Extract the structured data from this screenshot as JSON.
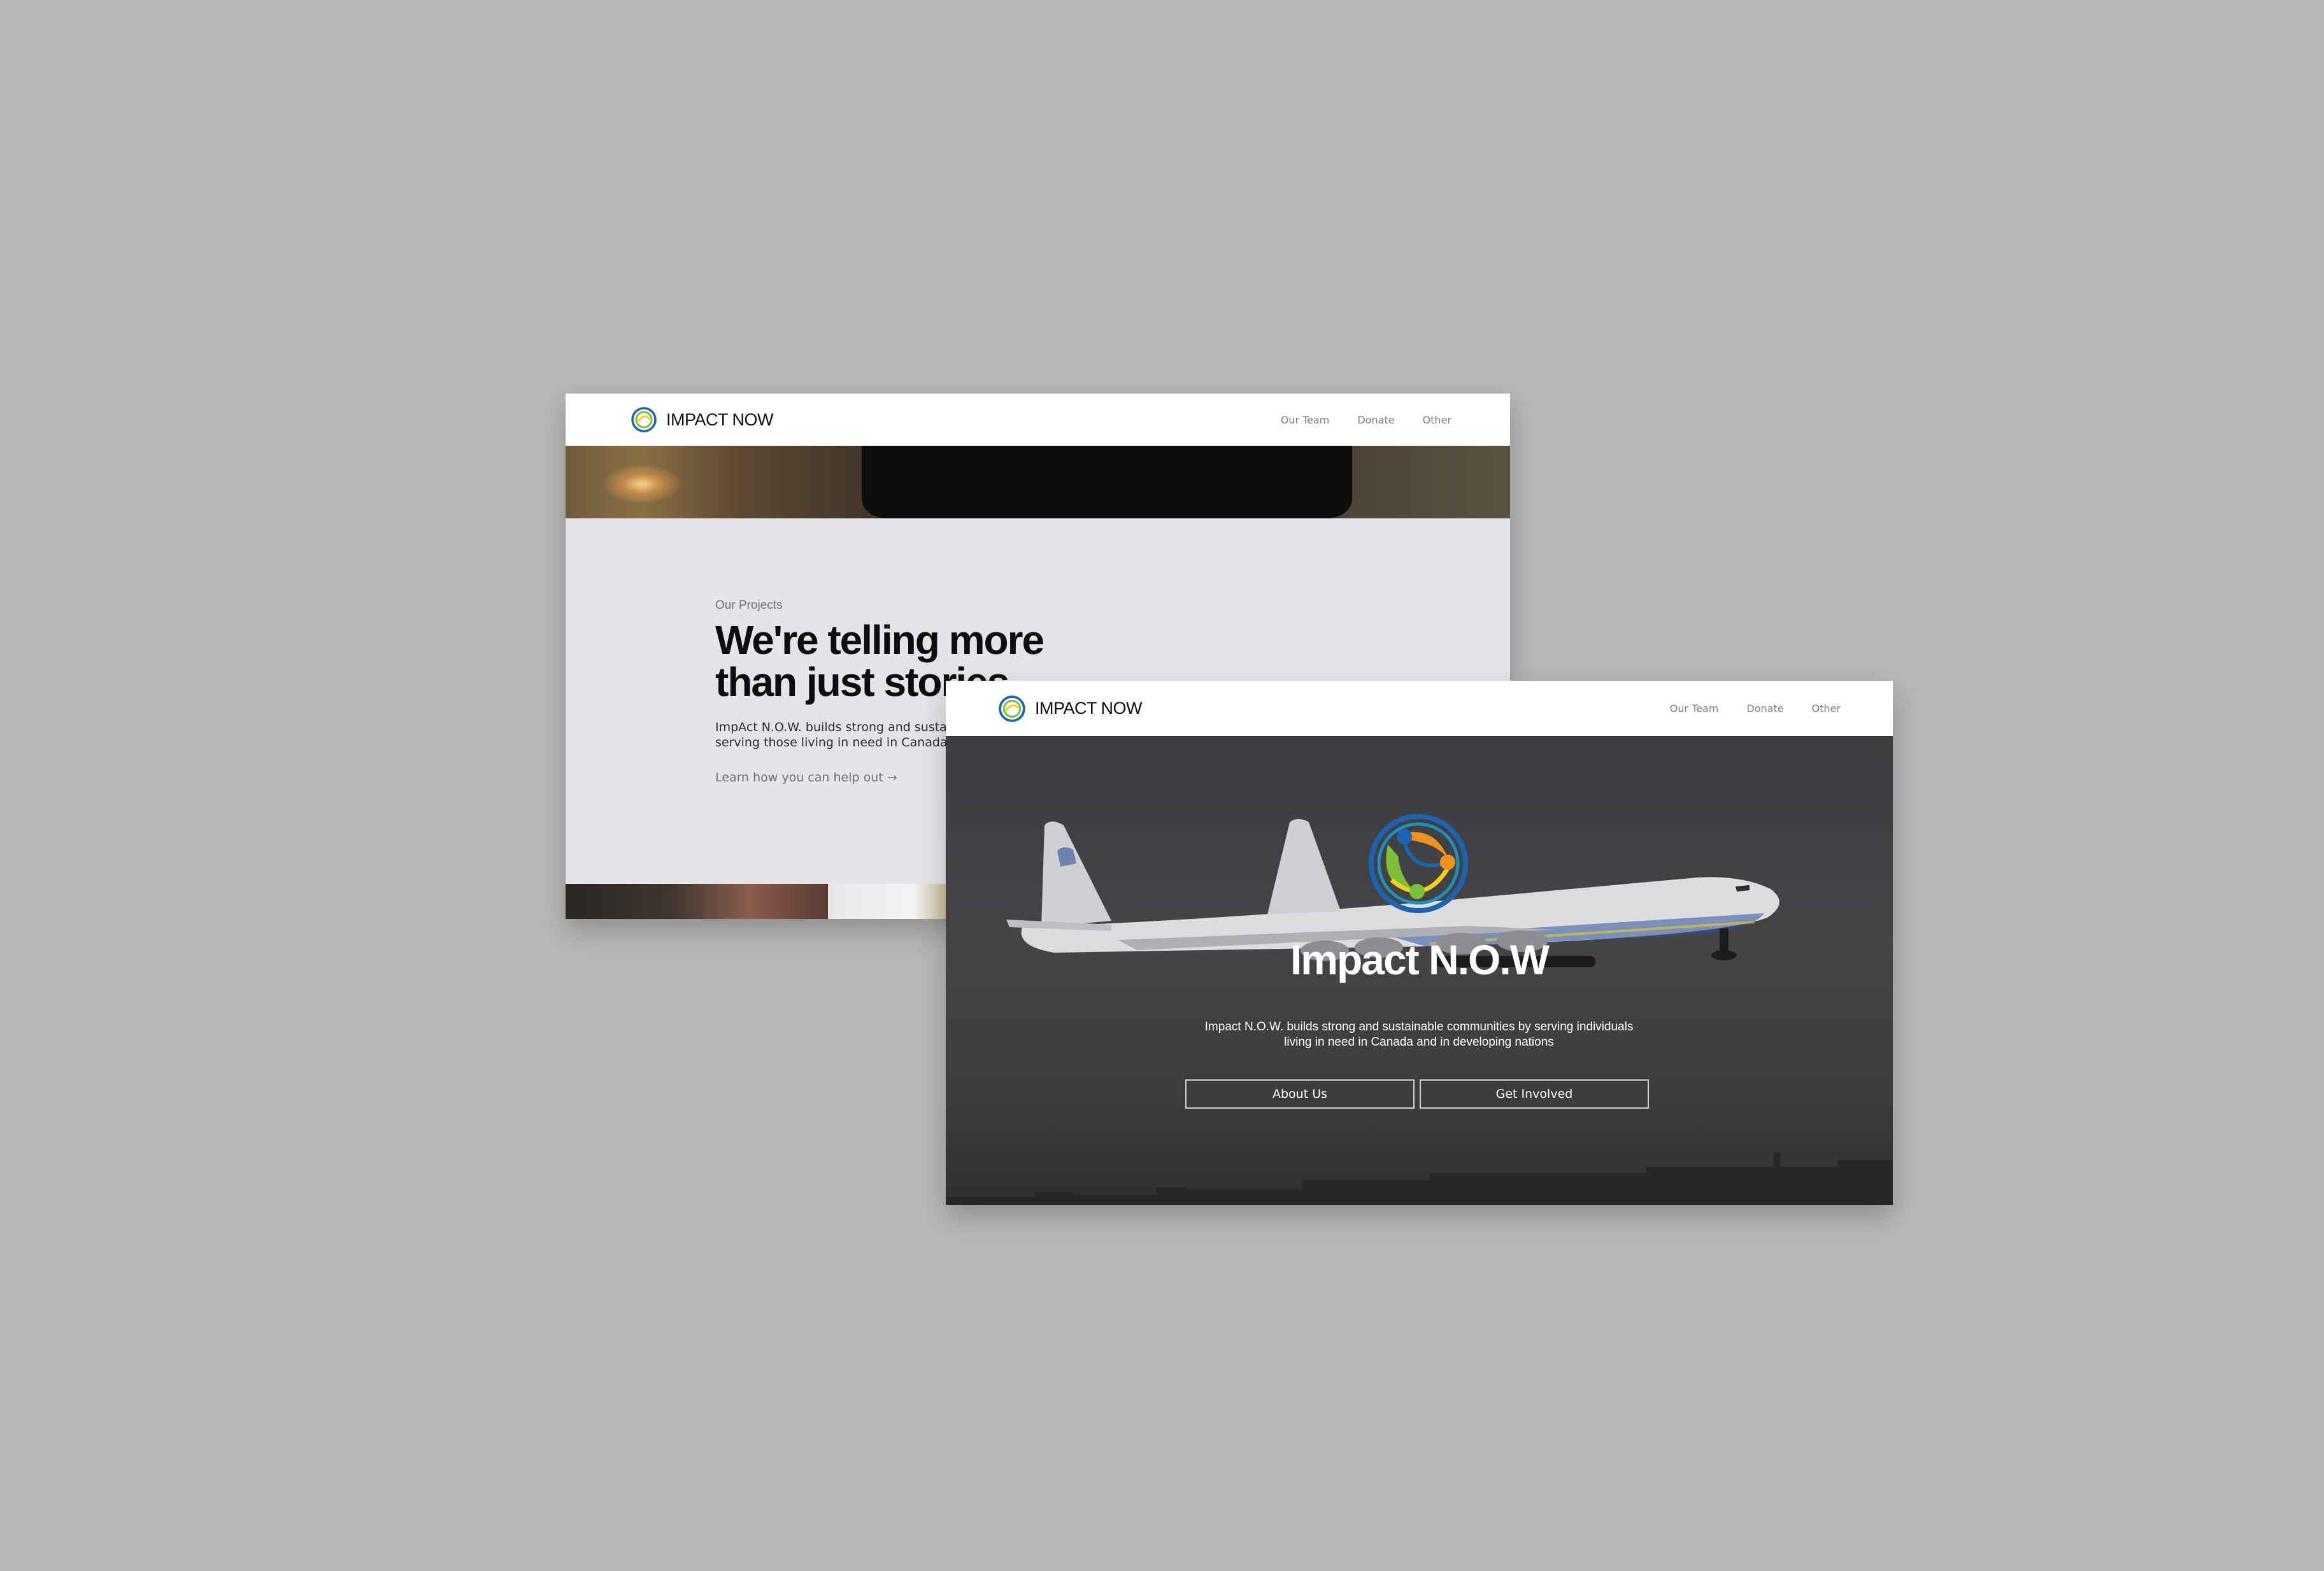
{
  "back_page": {
    "brand": "IMPACT NOW",
    "nav": [
      "Our Team",
      "Donate",
      "Other"
    ],
    "eyebrow": "Our Projects",
    "headline_line1": "We're telling more",
    "headline_line2": "than just stories",
    "body_line1": "ImpAct N.O.W. builds strong and sustainal",
    "body_line2": "serving those living in need in Canada and",
    "learn_link": "Learn how you can help out →"
  },
  "front_page": {
    "brand": "IMPACT NOW",
    "nav": [
      "Our Team",
      "Donate",
      "Other"
    ],
    "hero_title": "Impact N.O.W",
    "hero_text_line1": "Impact N.O.W. builds strong and sustainable communities by serving individuals",
    "hero_text_line2": "living in need in Canada and in developing nations",
    "buttons": [
      "About Us",
      "Get Involved"
    ]
  },
  "colors": {
    "canvas": "#b6b8b6",
    "logo_blue": "#1e63b0",
    "logo_green": "#7bbf3a",
    "logo_orange": "#f0921e",
    "logo_yellow": "#f2d21b",
    "logo_teal": "#1f8fbf"
  }
}
